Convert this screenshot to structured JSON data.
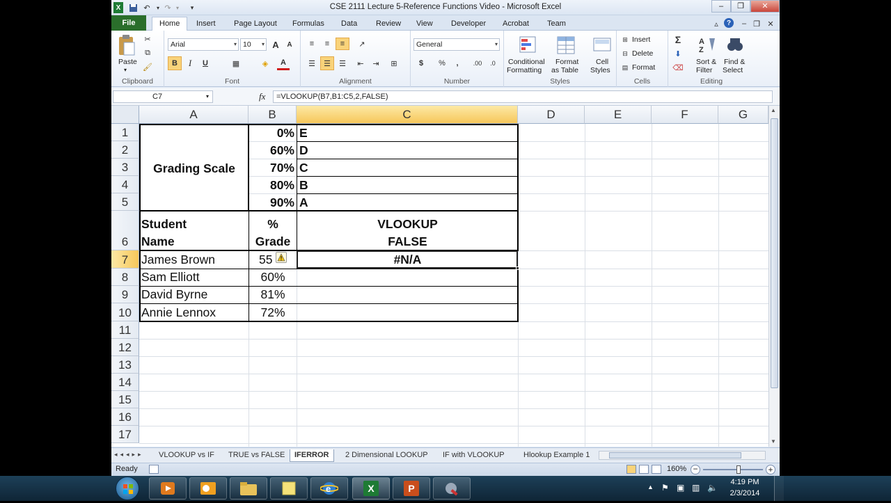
{
  "window": {
    "title": "CSE 2111 Lecture 5-Reference Functions Video  -  Microsoft Excel",
    "quick_access": [
      "save-icon",
      "undo-icon",
      "redo-icon"
    ],
    "controls": {
      "minimize": "–",
      "restore": "❐",
      "close": "✕"
    }
  },
  "ribbon_tabs": [
    "File",
    "Home",
    "Insert",
    "Page Layout",
    "Formulas",
    "Data",
    "Review",
    "View",
    "Developer",
    "Acrobat",
    "Team"
  ],
  "active_tab": "Home",
  "ribbon": {
    "clipboard": {
      "paste": "Paste",
      "group": "Clipboard"
    },
    "font": {
      "name": "Arial",
      "size": "10",
      "bold": "B",
      "italic": "I",
      "underline": "U",
      "grow": "A",
      "shrink": "A",
      "color": "A",
      "group": "Font"
    },
    "alignment": {
      "group": "Alignment"
    },
    "number": {
      "format": "General",
      "currency": "$",
      "percent": "%",
      "comma": ",",
      "group": "Number"
    },
    "styles": {
      "conditional": "Conditional",
      "conditional2": "Formatting",
      "format_table": "Format",
      "format_table2": "as Table",
      "cell_styles": "Cell",
      "cell_styles2": "Styles",
      "group": "Styles"
    },
    "cells": {
      "insert": "Insert",
      "delete": "Delete",
      "format": "Format",
      "group": "Cells"
    },
    "editing": {
      "sort": "Sort &",
      "sort2": "Filter",
      "find": "Find &",
      "find2": "Select",
      "group": "Editing",
      "sigma": "Σ"
    }
  },
  "formula_bar": {
    "name_box": "C7",
    "fx": "fx",
    "formula": "=VLOOKUP(B7,B1:C5,2,FALSE)"
  },
  "columns": [
    "A",
    "B",
    "C",
    "D",
    "E",
    "F",
    "G"
  ],
  "rows": [
    "1",
    "2",
    "3",
    "4",
    "5",
    "6",
    "7",
    "8",
    "9",
    "10",
    "11",
    "12",
    "13",
    "14",
    "15",
    "16",
    "17"
  ],
  "cells": {
    "A_merged": "Grading Scale",
    "B1": "0%",
    "B2": "60%",
    "B3": "70%",
    "B4": "80%",
    "B5": "90%",
    "C1": "E",
    "C2": "D",
    "C3": "C",
    "C4": "B",
    "C5": "A",
    "A6a": "Student",
    "A6b": "Name",
    "B6a": "%",
    "B6b": "Grade",
    "C6a": "VLOOKUP",
    "C6b": "FALSE",
    "A7": "James Brown",
    "A8": "Sam Elliott",
    "A9": "David Byrne",
    "A10": "Annie Lennox",
    "B7": "55",
    "B8": "60%",
    "B9": "81%",
    "B10": "72%",
    "C7": "#N/A"
  },
  "sheet_tabs": [
    "VLOOKUP vs IF",
    "TRUE vs FALSE",
    "IFERROR",
    "2 Dimensional LOOKUP",
    "IF with VLOOKUP",
    "Hlookup Example 1"
  ],
  "active_sheet": "IFERROR",
  "status": {
    "ready": "Ready",
    "zoom": "160%"
  },
  "taskbar": {
    "apps": [
      "windows-start",
      "media-player",
      "outlook",
      "explorer",
      "notes",
      "internet-explorer",
      "excel",
      "powerpoint",
      "tools"
    ],
    "excel_label": "X",
    "ppt_label": "P",
    "time": "4:19 PM",
    "date": "2/3/2014"
  },
  "colors": {
    "selected_header": "#f6c75a",
    "file_tab": "#2a6e2b",
    "taskbar": "#1d4058"
  }
}
